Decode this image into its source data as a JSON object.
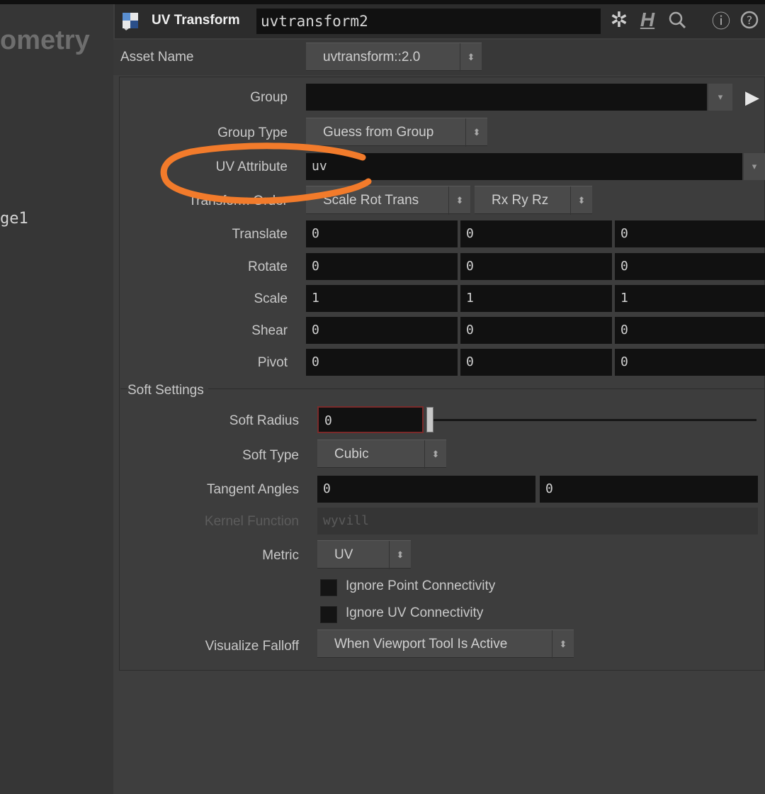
{
  "left_panel": {
    "title": "ometry",
    "node_label": "ge1"
  },
  "header": {
    "node_type": "UV Transform",
    "node_name": "uvtransform2",
    "icons": [
      "gear-icon",
      "hda-icon",
      "search-icon",
      "info-icon",
      "help-icon"
    ],
    "icon_glyphs": {
      "gear": "✲",
      "hda": "H",
      "search": "⚲",
      "info": "ⓘ",
      "help": "?"
    }
  },
  "asset": {
    "label": "Asset Name",
    "value": "uvtransform::2.0",
    "arrow": "⬍"
  },
  "params": {
    "group": {
      "label": "Group",
      "value": "",
      "dropdown": "▾",
      "arrow": "▶"
    },
    "group_type": {
      "label": "Group Type",
      "value": "Guess from Group",
      "arrow": "⬍"
    },
    "uv_attribute": {
      "label": "UV Attribute",
      "value": "uv",
      "dropdown": "▾"
    },
    "transform_order": {
      "label": "Transform Order",
      "value1": "Scale Rot Trans",
      "value2": "Rx Ry Rz",
      "arrow": "⬍"
    },
    "translate": {
      "label": "Translate",
      "values": [
        "0",
        "0",
        "0"
      ]
    },
    "rotate": {
      "label": "Rotate",
      "values": [
        "0",
        "0",
        "0"
      ]
    },
    "scale": {
      "label": "Scale",
      "values": [
        "1",
        "1",
        "1"
      ]
    },
    "shear": {
      "label": "Shear",
      "values": [
        "0",
        "0",
        "0"
      ]
    },
    "pivot": {
      "label": "Pivot",
      "values": [
        "0",
        "0",
        "0"
      ]
    }
  },
  "soft": {
    "section_label": "Soft Settings",
    "radius": {
      "label": "Soft Radius",
      "value": "0",
      "slider_fraction": 0
    },
    "type": {
      "label": "Soft Type",
      "value": "Cubic",
      "arrow": "⬍"
    },
    "tangent": {
      "label": "Tangent Angles",
      "values": [
        "0",
        "0"
      ]
    },
    "kernel": {
      "label": "Kernel Function",
      "value": "wyvill"
    },
    "metric": {
      "label": "Metric",
      "value": "UV",
      "arrow": "⬍"
    },
    "ignore_point": {
      "label": "Ignore Point Connectivity",
      "checked": false
    },
    "ignore_uv": {
      "label": "Ignore UV Connectivity",
      "checked": false
    },
    "visualize": {
      "label": "Visualize Falloff",
      "value": "When Viewport Tool Is Active",
      "arrow": "⬍"
    }
  },
  "colors": {
    "annotation": "#f27b2b",
    "soft_radius_border": "#7a2a2a"
  }
}
